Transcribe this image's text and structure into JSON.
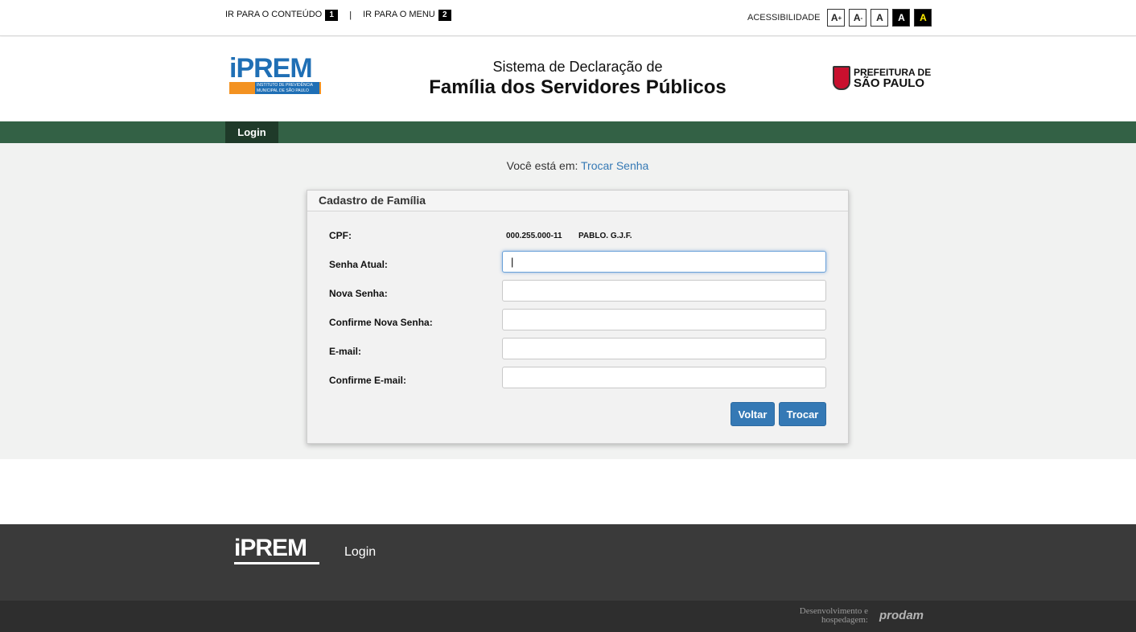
{
  "topbar": {
    "skip_content": "IR PARA O CONTEÚDO",
    "skip_content_key": "1",
    "separator": "|",
    "skip_menu": "IR PARA O MENU",
    "skip_menu_key": "2",
    "accessibility_label": "ACESSIBILIDADE",
    "font_increase": "A",
    "font_increase_sup": "+",
    "font_decrease": "A",
    "font_decrease_sup": "-",
    "font_normal": "A",
    "contrast_black": "A",
    "contrast_yellow": "A"
  },
  "header": {
    "logo_left": "iPREM",
    "logo_left_sub": "INSTITUTO DE PREVIDÊNCIA MUNICIPAL DE SÃO PAULO",
    "title_line1": "Sistema de Declaração de",
    "title_line2": "Família dos Servidores Públicos",
    "logo_right_line1": "PREFEITURA DE",
    "logo_right_line2": "SÃO PAULO"
  },
  "nav": {
    "items": [
      {
        "label": "Login"
      }
    ]
  },
  "breadcrumb": {
    "prefix": "Você está em:",
    "current": "Trocar Senha"
  },
  "form": {
    "title": "Cadastro de Família",
    "cpf_label": "CPF:",
    "cpf_value": "000.255.000-11",
    "name_value": "PABLO. G.J.F.",
    "current_password_label": "Senha Atual:",
    "current_password_value": "|",
    "new_password_label": "Nova Senha:",
    "confirm_password_label": "Confirme Nova Senha:",
    "email_label": "E-mail:",
    "confirm_email_label": "Confirme E-mail:",
    "back_button": "Voltar",
    "submit_button": "Trocar"
  },
  "footer": {
    "logo": "iPREM",
    "link": "Login",
    "dev_text": "Desenvolvimento e hospedagem:",
    "dev_logo": "prodam"
  },
  "colors": {
    "nav_green": "#336145",
    "nav_active": "#1f3a29",
    "button_blue": "#3579b5",
    "link_blue": "#3579b5",
    "footer_dark": "#3a3a3a"
  }
}
